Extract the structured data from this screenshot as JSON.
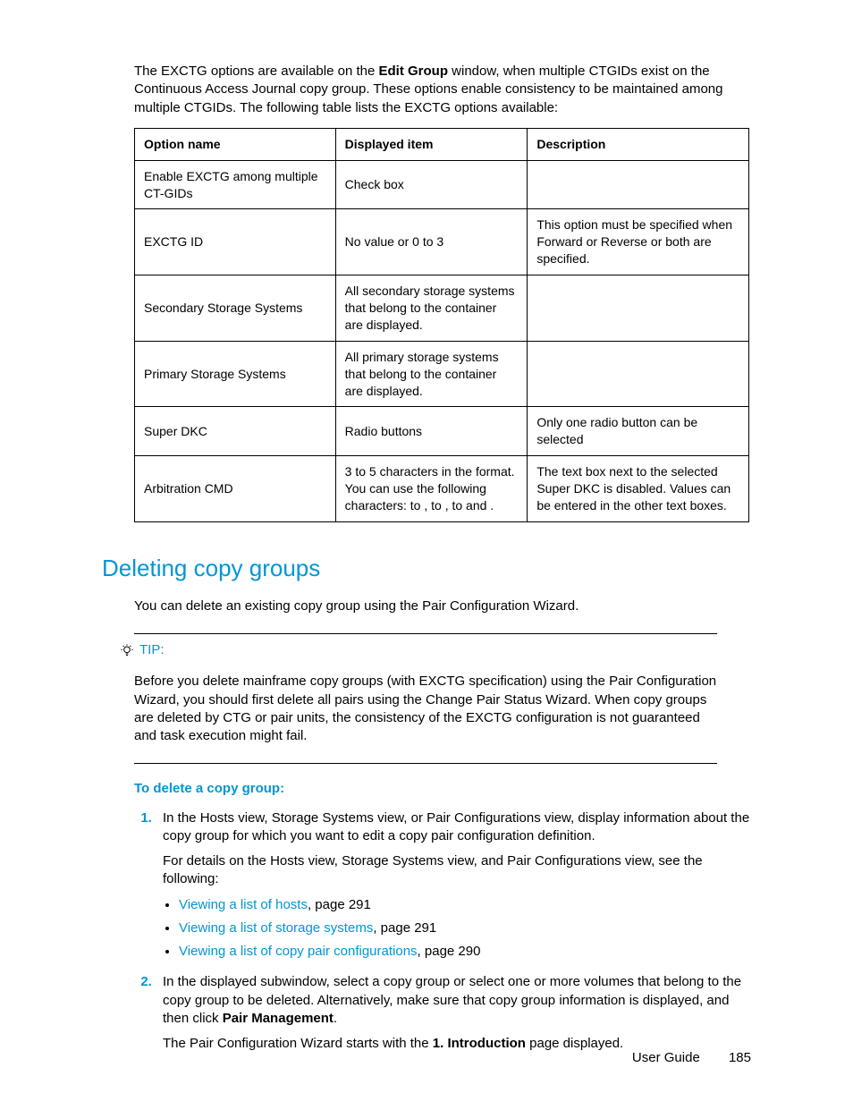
{
  "intro": {
    "p1a": "The EXCTG options are available on the ",
    "p1b": "Edit Group",
    "p1c": " window, when multiple CTGIDs exist on the Continuous Access Journal copy group. These options enable consistency to be maintained among multiple CTGIDs. The following table lists the EXCTG options available:"
  },
  "table": {
    "headers": [
      "Option name",
      "Displayed item",
      "Description"
    ],
    "rows": [
      [
        "Enable EXCTG among multiple CT-GIDs",
        "Check box",
        ""
      ],
      [
        "EXCTG ID",
        "No value or 0 to 3",
        "This option must be specified when Forward or Reverse or both are specified."
      ],
      [
        "Secondary Storage Systems",
        "All secondary storage systems that belong to the container are displayed.",
        ""
      ],
      [
        "Primary Storage Systems",
        "All primary storage systems that belong to the container are displayed.",
        ""
      ],
      [
        "Super DKC",
        "Radio buttons",
        "Only one radio button can be selected"
      ],
      [
        "Arbitration CMD",
        "3 to 5 characters in the                         format. You can use the following characters:     to   ,     to   ,     to    and   .",
        "The text box next to the selected Super DKC is disabled. Values can be entered in the other text boxes."
      ]
    ]
  },
  "section_heading": "Deleting copy groups",
  "section_intro": "You can delete an existing copy group using the Pair Configuration Wizard.",
  "tip": {
    "label": "TIP:",
    "body": "Before you delete mainframe copy groups (with EXCTG specification) using the Pair Configuration Wizard, you should first delete all pairs using the Change Pair Status Wizard. When copy groups are deleted by CTG or pair units, the consistency of the EXCTG configuration is not guaranteed and task execution might fail."
  },
  "procedure": {
    "title": "To delete a copy group:",
    "step1": {
      "p1": "In the Hosts view, Storage Systems view, or Pair Configurations view, display information about the copy group for which you want to edit a copy pair configuration definition.",
      "p2": "For details on the Hosts view, Storage Systems view, and Pair Configurations view, see the following:",
      "links": [
        {
          "text": "Viewing a list of hosts",
          "suffix": ", page 291"
        },
        {
          "text": "Viewing a list of storage systems",
          "suffix": ", page 291"
        },
        {
          "text": "Viewing a list of copy pair configurations",
          "suffix": ", page 290"
        }
      ]
    },
    "step2": {
      "p1a": "In the displayed subwindow, select a copy group or select one or more volumes that belong to the copy group to be deleted. Alternatively, make sure that copy group information is displayed, and then click ",
      "p1b": "Pair Management",
      "p1c": ".",
      "p2a": "The Pair Configuration Wizard starts with the ",
      "p2b": "1. Introduction",
      "p2c": " page displayed."
    }
  },
  "footer": {
    "label": "User Guide",
    "page": "185"
  }
}
